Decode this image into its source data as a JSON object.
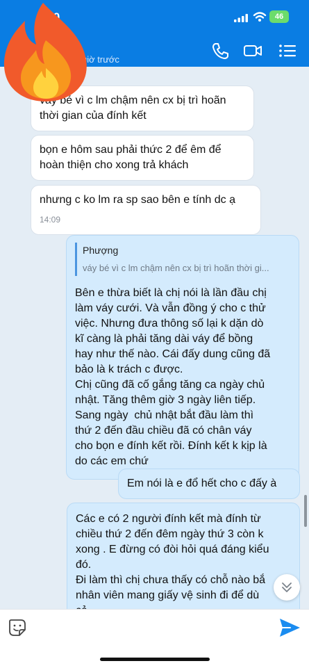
{
  "status_bar": {
    "time": ".0",
    "battery": "46"
  },
  "header": {
    "last_seen": "giờ trước"
  },
  "messages": [
    {
      "id": "m1",
      "side": "in",
      "text": "váy bé vì c lm chậm nên cx bị trì hoãn\nthời gian của đính kết"
    },
    {
      "id": "m2",
      "side": "in",
      "text": "bọn e hôm sau phải thức 2 để êm để\nhoàn thiện cho xong trả khách"
    },
    {
      "id": "m3",
      "side": "in",
      "text": "nhưng c ko lm ra sp sao bên e tính dc ạ",
      "time": "14:09"
    },
    {
      "id": "m4",
      "side": "out",
      "quote": {
        "name": "Phượng",
        "text": "váy bé vì c lm chậm nên cx bị trì hoãn thời gi..."
      },
      "text": "Bên e thừa biết là chị nói là lần đầu chị\nlàm váy cưới. Và vẫn đồng ý cho c thử\nviệc. Nhưng đưa thông số lại k dặn dò\nkĩ càng là phải tăng dài váy để bồng\nhay như thế nào. Cái đấy dung cũng đã\nbảo là k trách c được.\nChị cũng đã cố gắng tăng ca ngày chủ\nnhật. Tăng thêm giờ 3 ngày liên tiếp.\nSang ngày  chủ nhật bắt đầu làm thì\nthứ 2 đến đầu chiều đã có chân váy\ncho bọn e đính kết rồi. Đính kết k kịp là\ndo các em chứ"
    },
    {
      "id": "m5",
      "side": "out",
      "text": "Em nói là e đổ hết cho c đấy à"
    },
    {
      "id": "m6",
      "side": "out",
      "text": "Các e có 2 người đính kết mà đính từ\nchiều thứ 2 đến đêm ngày thứ 3 còn k\nxong . E đừng có đòi hỏi quá đáng kiểu\nđó.\nĐi làm thì chị chưa thấy có chỗ nào bắ\nnhân viên mang giấy vệ sinh đi để dù\ncả"
    }
  ],
  "composer": {
    "placeholder": ""
  },
  "colors": {
    "header_bg": "#0a7de3",
    "chat_bg": "#e4edf5",
    "outgoing_bubble": "#d4ebfd",
    "incoming_bubble": "#ffffff",
    "send_blue": "#1a8cf0"
  },
  "icons": {
    "header": [
      "phone-icon",
      "video-call-icon",
      "menu-list-icon"
    ],
    "composer": [
      "emoji-sticker-icon",
      "send-icon"
    ],
    "overlay": [
      "fire-emoji-icon",
      "scroll-down-icon"
    ]
  }
}
